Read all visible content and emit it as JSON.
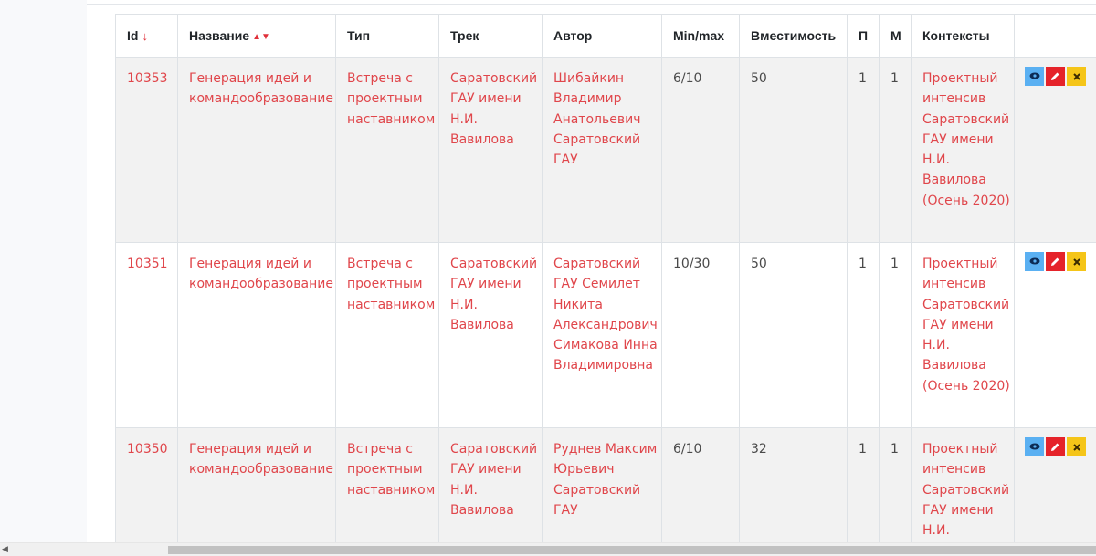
{
  "table": {
    "headers": {
      "id": "Id",
      "name": "Название",
      "type": "Тип",
      "track": "Трек",
      "author": "Автор",
      "minmax": "Min/max",
      "capacity": "Вместимость",
      "p": "П",
      "m": "М",
      "contexts": "Контексты"
    },
    "sort_icons": {
      "id_icon": "↓",
      "name_icon": "▲▼"
    },
    "rows": [
      {
        "id": "10353",
        "name": "Генерация идей и командообразование",
        "type": "Встреча с проектным наставником",
        "track": "Саратовский ГАУ имени Н.И. Вавилова",
        "author": "Шибайкин Владимир Анатольевич Саратовский ГАУ",
        "minmax": "6/10",
        "capacity": "50",
        "p": "1",
        "m": "1",
        "contexts": "Проектный интенсив Саратовский ГАУ имени Н.И. Вавилова (Осень 2020)"
      },
      {
        "id": "10351",
        "name": "Генерация идей и командообразование",
        "type": "Встреча с проектным наставником",
        "track": "Саратовский ГАУ имени Н.И. Вавилова",
        "author": "Саратовский ГАУ Семилет Никита Александрович Симакова Инна Владимировна",
        "minmax": "10/30",
        "capacity": "50",
        "p": "1",
        "m": "1",
        "contexts": "Проектный интенсив Саратовский ГАУ имени Н.И. Вавилова (Осень 2020)"
      },
      {
        "id": "10350",
        "name": "Генерация идей и командообразование",
        "type": "Встреча с проектным наставником",
        "track": "Саратовский ГАУ имени Н.И. Вавилова",
        "author": "Руднев Максим Юрьевич Саратовский ГАУ",
        "minmax": "6/10",
        "capacity": "32",
        "p": "1",
        "m": "1",
        "contexts": "Проектный интенсив Саратовский ГАУ имени Н.И."
      }
    ],
    "action_icons": {
      "view": "eye-icon",
      "edit": "pencil-icon",
      "delete": "close-icon"
    }
  },
  "colors": {
    "link": "#e0464b",
    "view_button": "#5ab0f2",
    "edit_button": "#e5232a",
    "delete_button": "#f5c518"
  }
}
